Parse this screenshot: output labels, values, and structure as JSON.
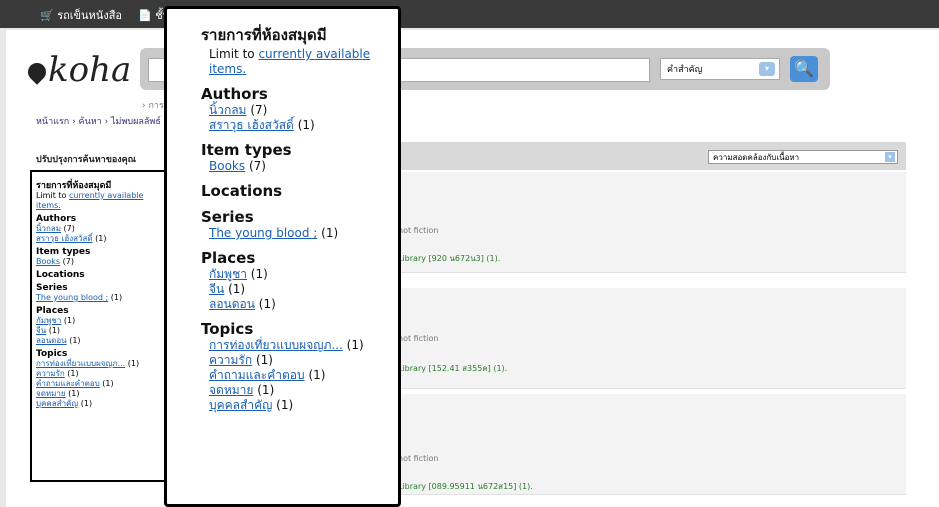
{
  "topbar": {
    "cart": "🛒 รถเข็นหนังสือ",
    "lists": "📄 ชั้น"
  },
  "logo": "koha",
  "search": {
    "index_label": "คำสำคัญ",
    "chev": "▾",
    "go": "🔍"
  },
  "breadcrumbs": {
    "masthead": "› การ",
    "trail": "หน้าแรก › ค้นหา › ไม่พบผลลัพธ์"
  },
  "refine_title": "ปรับปรุงการค้นหาของคุณ",
  "sort_label": "ความสอดคล้องกับเนื้อหา",
  "sidebar": {
    "libraries": "รายการที่ห้องสมุดมี",
    "limit_prefix": "Limit to ",
    "limit_link": "currently available items.",
    "authors": "Authors",
    "author1": "นิ้วกลม",
    "author1_count": "(7)",
    "author2": "สราวุธ เฮ้งสวัสดิ์",
    "author2_count": "(1)",
    "itemtypes": "Item types",
    "books": "Books",
    "books_count": "(7)",
    "locations": "Locations",
    "series": "Series",
    "series1": "The young blood ;",
    "series1_count": "(1)",
    "places": "Places",
    "place1": "กัมพูชา",
    "place1_count": "(1)",
    "place2": "จีน",
    "place2_count": "(1)",
    "place3": "ลอนดอน",
    "place3_count": "(1)",
    "topics": "Topics",
    "topic1": "การท่องเที่ยวแบบผจญภ...",
    "topic1_count": "(1)",
    "topic2": "ความรัก",
    "topic2_count": "(1)",
    "topic3": "คำถามและคำตอบ",
    "topic3_count": "(1)",
    "topic4": "จดหมาย",
    "topic4_count": "(1)",
    "topic5": "บุคคลสำคัญ",
    "topic5_count": "(1)"
  },
  "results": [
    {
      "type": "not fiction",
      "loc": "Library [920 น672น3] (1)."
    },
    {
      "type": "not fiction",
      "loc": "Library [152.41 ส355ค] (1)."
    },
    {
      "type": "not fiction",
      "loc": "Library [089.95911 น672ส15] (1)."
    }
  ]
}
